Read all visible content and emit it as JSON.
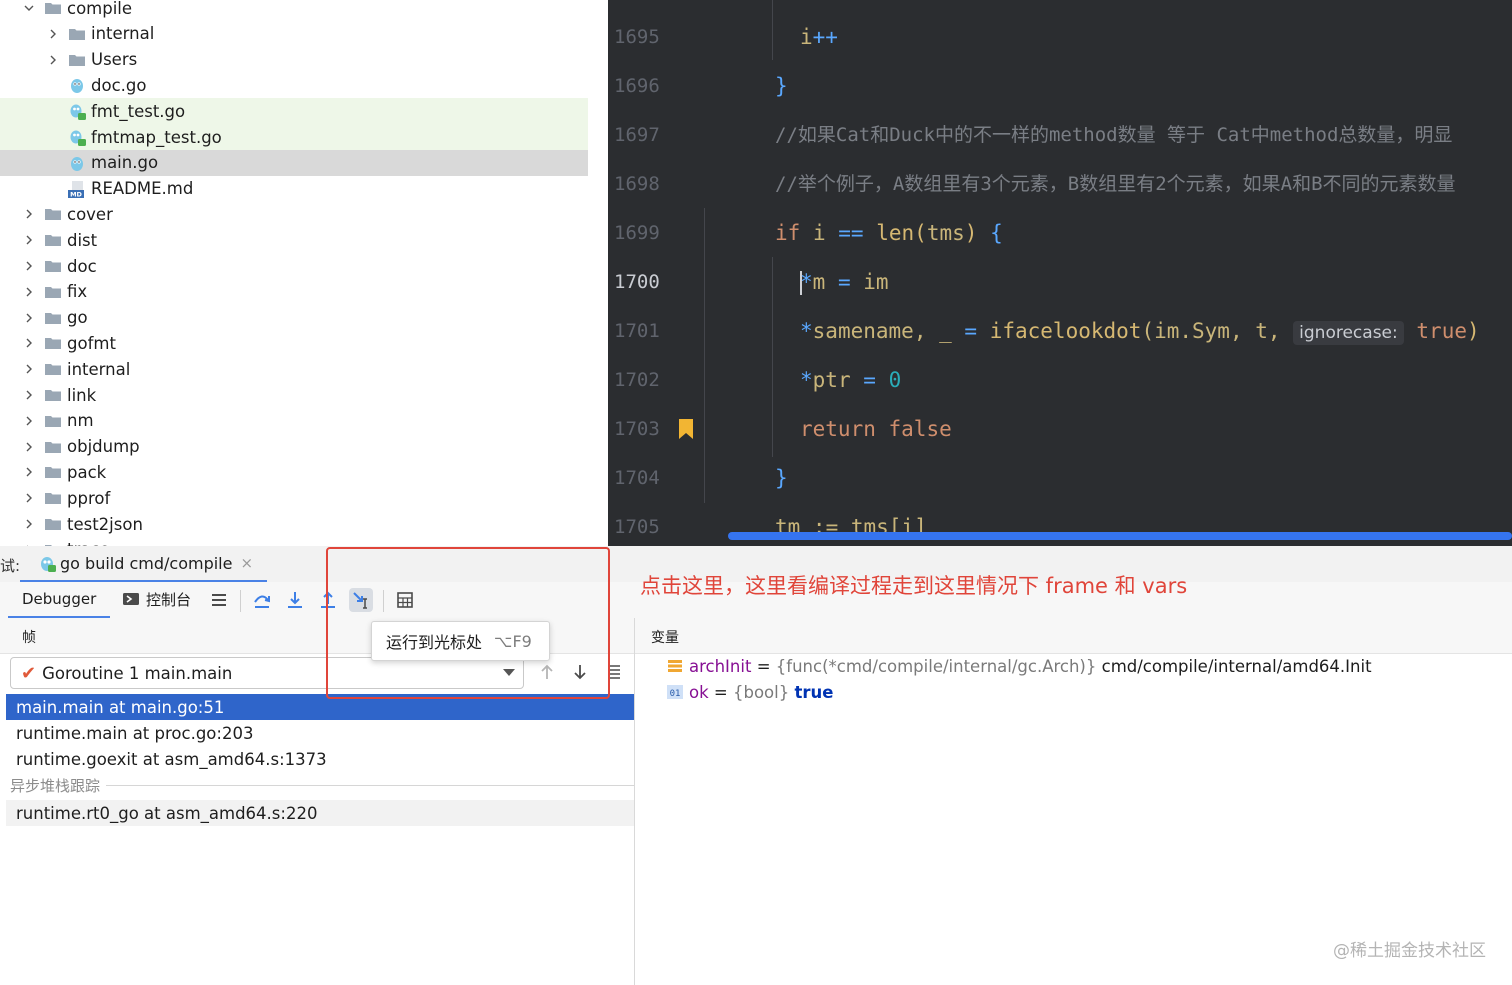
{
  "tree": {
    "items": [
      {
        "label": "compile",
        "type": "folder",
        "expanded": true,
        "depth": 1
      },
      {
        "label": "internal",
        "type": "folder",
        "expanded": false,
        "depth": 2
      },
      {
        "label": "Users",
        "type": "folder",
        "expanded": false,
        "depth": 2
      },
      {
        "label": "doc.go",
        "type": "go",
        "depth": 2
      },
      {
        "label": "fmt_test.go",
        "type": "go-test",
        "depth": 2,
        "state": "modified"
      },
      {
        "label": "fmtmap_test.go",
        "type": "go-test",
        "depth": 2,
        "state": "modified"
      },
      {
        "label": "main.go",
        "type": "go",
        "depth": 2,
        "state": "selected"
      },
      {
        "label": "README.md",
        "type": "md",
        "depth": 2
      },
      {
        "label": "cover",
        "type": "folder",
        "expanded": false,
        "depth": 1
      },
      {
        "label": "dist",
        "type": "folder",
        "expanded": false,
        "depth": 1
      },
      {
        "label": "doc",
        "type": "folder",
        "expanded": false,
        "depth": 1
      },
      {
        "label": "fix",
        "type": "folder",
        "expanded": false,
        "depth": 1
      },
      {
        "label": "go",
        "type": "folder",
        "expanded": false,
        "depth": 1
      },
      {
        "label": "gofmt",
        "type": "folder",
        "expanded": false,
        "depth": 1
      },
      {
        "label": "internal",
        "type": "folder",
        "expanded": false,
        "depth": 1
      },
      {
        "label": "link",
        "type": "folder",
        "expanded": false,
        "depth": 1
      },
      {
        "label": "nm",
        "type": "folder",
        "expanded": false,
        "depth": 1
      },
      {
        "label": "objdump",
        "type": "folder",
        "expanded": false,
        "depth": 1
      },
      {
        "label": "pack",
        "type": "folder",
        "expanded": false,
        "depth": 1
      },
      {
        "label": "pprof",
        "type": "folder",
        "expanded": false,
        "depth": 1
      },
      {
        "label": "test2json",
        "type": "folder",
        "expanded": false,
        "depth": 1
      },
      {
        "label": "trace",
        "type": "folder",
        "expanded": false,
        "depth": 1
      }
    ]
  },
  "editor": {
    "current_line": "1700",
    "lines": [
      {
        "num": "1695",
        "code": "i++"
      },
      {
        "num": "1696",
        "code": "}"
      },
      {
        "num": "1697",
        "comment": "//如果Cat和Duck中的不一样的method数量 等于 Cat中method总数量，明显"
      },
      {
        "num": "1698",
        "comment": "//举个例子，A数组里有3个元素，B数组里有2个元素，如果A和B不同的元素数量"
      },
      {
        "num": "1699",
        "kw": "if",
        "var": "i",
        "op": "==",
        "fn": "len",
        "arg": "tms",
        "brace": "{"
      },
      {
        "num": "1700",
        "star": "*",
        "var": "m",
        "op": "=",
        "val": "im"
      },
      {
        "num": "1701",
        "star": "*",
        "var": "samename",
        "rest_a": ", _",
        "op": "=",
        "fn": "ifacelookdot",
        "args": "(im.Sym, t,",
        "hint_label": "ignorecase:",
        "hint_value": "true",
        "close": ")"
      },
      {
        "num": "1702",
        "star": "*",
        "var": "ptr",
        "op": "=",
        "val": "0"
      },
      {
        "num": "1703",
        "kw": "return",
        "val": "false"
      },
      {
        "num": "1704",
        "code": "}"
      },
      {
        "num": "1705",
        "code": "tm := tms[i]"
      }
    ]
  },
  "tabbar": {
    "prefix": "试:",
    "run_config": "go build cmd/compile",
    "close_glyph": "×"
  },
  "toolbar": {
    "debugger_tab": "Debugger",
    "console_tab": "控制台"
  },
  "tooltip": {
    "label": "运行到光标处",
    "shortcut": "⌥F9"
  },
  "annotation": {
    "text": "点击这里，这里看编译过程走到这里情况下 frame 和 vars"
  },
  "frames": {
    "header": "帧",
    "goroutine": "Goroutine 1 main.main",
    "items": [
      {
        "label": "main.main at main.go:51",
        "selected": true
      },
      {
        "label": "runtime.main at proc.go:203"
      },
      {
        "label": "runtime.goexit at asm_amd64.s:1373"
      }
    ],
    "async_label": "异步堆栈跟踪",
    "async_items": [
      {
        "label": "runtime.rt0_go at asm_amd64.s:220"
      }
    ]
  },
  "variables": {
    "header": "变量",
    "items": [
      {
        "name": "archInit",
        "eq": "=",
        "type": "{func(*cmd/compile/internal/gc.Arch)}",
        "value": "cmd/compile/internal/amd64.Init",
        "icon": "field-icon"
      },
      {
        "name": "ok",
        "eq": "=",
        "type": "{bool}",
        "value": "true",
        "icon": "bool-icon",
        "icon_text": "01"
      }
    ]
  },
  "watermark": "@稀土掘金技术社区",
  "colors": {
    "editor_bg": "#2b2d30",
    "accent": "#3574f0",
    "selection": "#2f65ca",
    "annotation": "#e0453a"
  }
}
